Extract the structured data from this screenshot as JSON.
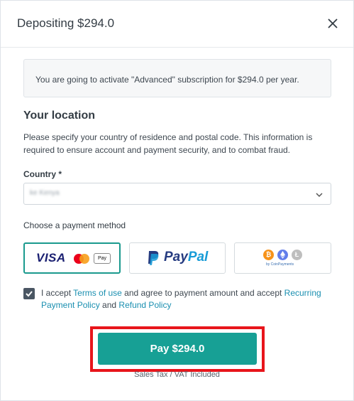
{
  "header": {
    "title": "Depositing $294.0",
    "close_icon": "close-icon"
  },
  "info": {
    "text": "You are going to activate \"Advanced\" subscription for $294.0 per year."
  },
  "location": {
    "title": "Your location",
    "description": "Please specify your country of residence and postal code. This information is required to ensure account and payment security, and to combat fraud.",
    "country_label": "Country *",
    "country_value": "ke Kenya"
  },
  "payment": {
    "label": "Choose a payment method",
    "methods": [
      {
        "name": "card",
        "text": "VISA",
        "extra_badge": "Pay",
        "selected": true
      },
      {
        "name": "paypal",
        "text_a": "Pay",
        "text_b": "Pal",
        "selected": false
      },
      {
        "name": "crypto",
        "text": "by CoinPayments",
        "selected": false
      }
    ]
  },
  "agreement": {
    "checked": true,
    "prefix": "I accept ",
    "terms_link": "Terms of use",
    "middle": " and agree to payment amount and accept ",
    "recurring_link": "Recurring Payment Policy",
    "and": " and ",
    "refund_link": "Refund Policy"
  },
  "pay_button": {
    "label": "Pay $294.0"
  },
  "tax_note": "Sales Tax / VAT Included",
  "colors": {
    "accent": "#17a095",
    "link": "#1a8fb0",
    "highlight": "#e8151b",
    "checkbox": "#4a5663"
  }
}
